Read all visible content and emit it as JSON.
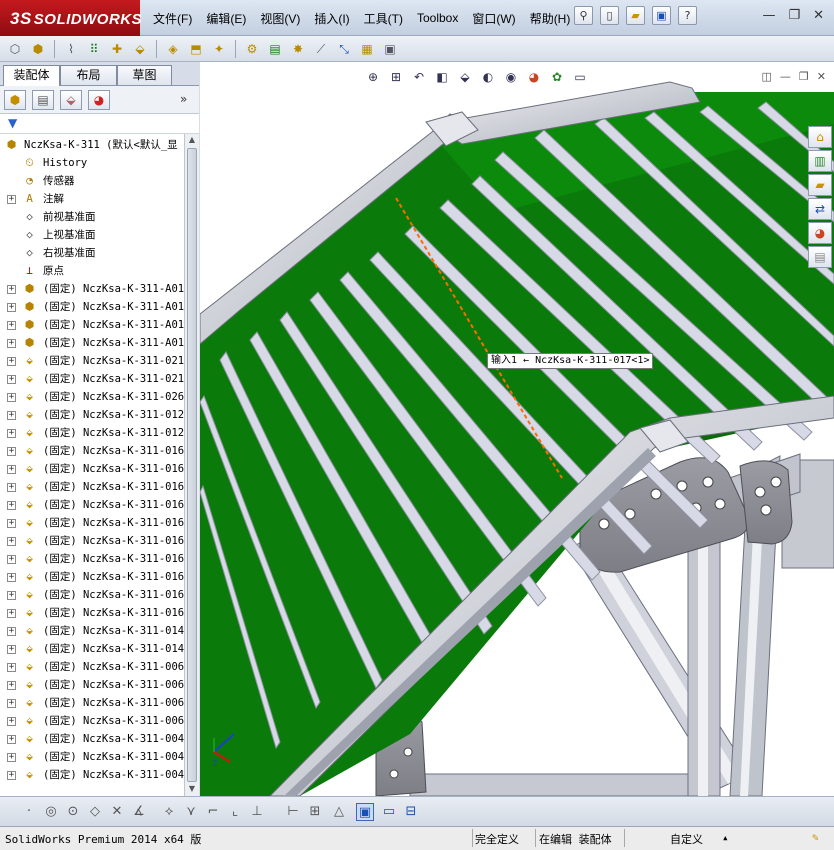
{
  "app": {
    "logo_prefix": "3S",
    "logo_text": "SOLIDWORKS"
  },
  "menu": [
    "文件(F)",
    "编辑(E)",
    "视图(V)",
    "插入(I)",
    "工具(T)",
    "Toolbox",
    "窗口(W)",
    "帮助(H)"
  ],
  "tabs": {
    "assembly": "装配体",
    "layout": "布局",
    "sketch": "草图"
  },
  "tree": {
    "root": "NczKsa-K-311  (默认<默认_显",
    "items": [
      {
        "label": "History",
        "icon": "history-icon",
        "expand": false
      },
      {
        "label": "传感器",
        "icon": "sensor-icon",
        "expand": false
      },
      {
        "label": "注解",
        "icon": "annotation-icon",
        "expand": true
      },
      {
        "label": "前视基准面",
        "icon": "plane-icon",
        "expand": false
      },
      {
        "label": "上视基准面",
        "icon": "plane-icon",
        "expand": false
      },
      {
        "label": "右视基准面",
        "icon": "plane-icon",
        "expand": false
      },
      {
        "label": "原点",
        "icon": "origin-icon",
        "expand": false
      },
      {
        "label": "(固定) NczKsa-K-311-A01",
        "icon": "assembly-icon",
        "expand": true
      },
      {
        "label": "(固定) NczKsa-K-311-A01",
        "icon": "assembly-icon",
        "expand": true
      },
      {
        "label": "(固定) NczKsa-K-311-A01",
        "icon": "assembly-icon",
        "expand": true
      },
      {
        "label": "(固定) NczKsa-K-311-A01",
        "icon": "assembly-icon",
        "expand": true
      },
      {
        "label": "(固定) NczKsa-K-311-021",
        "icon": "part-icon",
        "expand": true
      },
      {
        "label": "(固定) NczKsa-K-311-021",
        "icon": "part-icon",
        "expand": true
      },
      {
        "label": "(固定) NczKsa-K-311-026",
        "icon": "part-icon",
        "expand": true
      },
      {
        "label": "(固定) NczKsa-K-311-012",
        "icon": "part-icon",
        "expand": true
      },
      {
        "label": "(固定) NczKsa-K-311-012",
        "icon": "part-icon",
        "expand": true
      },
      {
        "label": "(固定) NczKsa-K-311-016",
        "icon": "part-icon",
        "expand": true
      },
      {
        "label": "(固定) NczKsa-K-311-016",
        "icon": "part-icon",
        "expand": true
      },
      {
        "label": "(固定) NczKsa-K-311-016",
        "icon": "part-icon",
        "expand": true
      },
      {
        "label": "(固定) NczKsa-K-311-016",
        "icon": "part-icon",
        "expand": true
      },
      {
        "label": "(固定) NczKsa-K-311-016",
        "icon": "part-icon",
        "expand": true
      },
      {
        "label": "(固定) NczKsa-K-311-016",
        "icon": "part-icon",
        "expand": true
      },
      {
        "label": "(固定) NczKsa-K-311-016",
        "icon": "part-icon",
        "expand": true
      },
      {
        "label": "(固定) NczKsa-K-311-016",
        "icon": "part-icon",
        "expand": true
      },
      {
        "label": "(固定) NczKsa-K-311-016",
        "icon": "part-icon",
        "expand": true
      },
      {
        "label": "(固定) NczKsa-K-311-016",
        "icon": "part-icon",
        "expand": true
      },
      {
        "label": "(固定) NczKsa-K-311-014",
        "icon": "part-icon",
        "expand": true
      },
      {
        "label": "(固定) NczKsa-K-311-014",
        "icon": "part-icon",
        "expand": true
      },
      {
        "label": "(固定) NczKsa-K-311-006",
        "icon": "part-icon",
        "expand": true
      },
      {
        "label": "(固定) NczKsa-K-311-006",
        "icon": "part-icon",
        "expand": true
      },
      {
        "label": "(固定) NczKsa-K-311-006",
        "icon": "part-icon",
        "expand": true
      },
      {
        "label": "(固定) NczKsa-K-311-006",
        "icon": "part-icon",
        "expand": true
      },
      {
        "label": "(固定) NczKsa-K-311-004",
        "icon": "part-icon",
        "expand": true
      },
      {
        "label": "(固定) NczKsa-K-311-004",
        "icon": "part-icon",
        "expand": true
      },
      {
        "label": "(固定) NczKsa-K-311-004",
        "icon": "part-icon",
        "expand": true
      }
    ]
  },
  "viewport": {
    "tooltip": "输入1 ← NczKsa-K-311-017<1>",
    "axis_labels": {
      "x": "X",
      "y": "Y",
      "z": "Z"
    },
    "colors": {
      "belt": "#0a7a0a",
      "cleat": "#d7dae6",
      "frame": "#c9ccd4",
      "plate": "#8f9098",
      "highlight": "#ff6a00"
    }
  },
  "status": {
    "version": "SolidWorks Premium 2014 x64 版",
    "constraint": "完全定义",
    "mode": "在编辑 装配体",
    "units": "自定义",
    "units_arrow": "▴"
  }
}
